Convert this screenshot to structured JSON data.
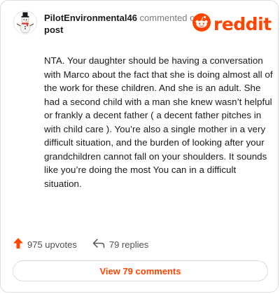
{
  "header": {
    "username": "PilotEnvironmental46",
    "action_text": "commented on",
    "target_text": "post",
    "logo_text": "reddit",
    "avatar_icon": "snowman-avatar-icon",
    "logo_icon": "reddit-alien-icon"
  },
  "comment": {
    "text": "NTA. Your daughter should be having a conversation with Marco about the fact that she is doing almost all of the work for these children. And she is an adult. She had a second child with a man she knew wasn’t helpful or frankly a decent father ( a decent father pitches in with child care ). You’re also a single mother in a very difficult situation, and the burden of looking after your grandchildren cannot fall on your shoulders. It sounds like you’re doing the most You can in a difficult situation."
  },
  "stats": {
    "upvotes": "975 upvotes",
    "replies": "79 replies",
    "upvote_icon": "upvote-arrow-icon",
    "reply_icon": "reply-arrow-icon"
  },
  "footer": {
    "view_button": "View 79 comments"
  },
  "colors": {
    "accent": "#ff4500",
    "text": "#1a1a1b",
    "muted": "#7c7c7c",
    "border": "#dcdcdc"
  }
}
